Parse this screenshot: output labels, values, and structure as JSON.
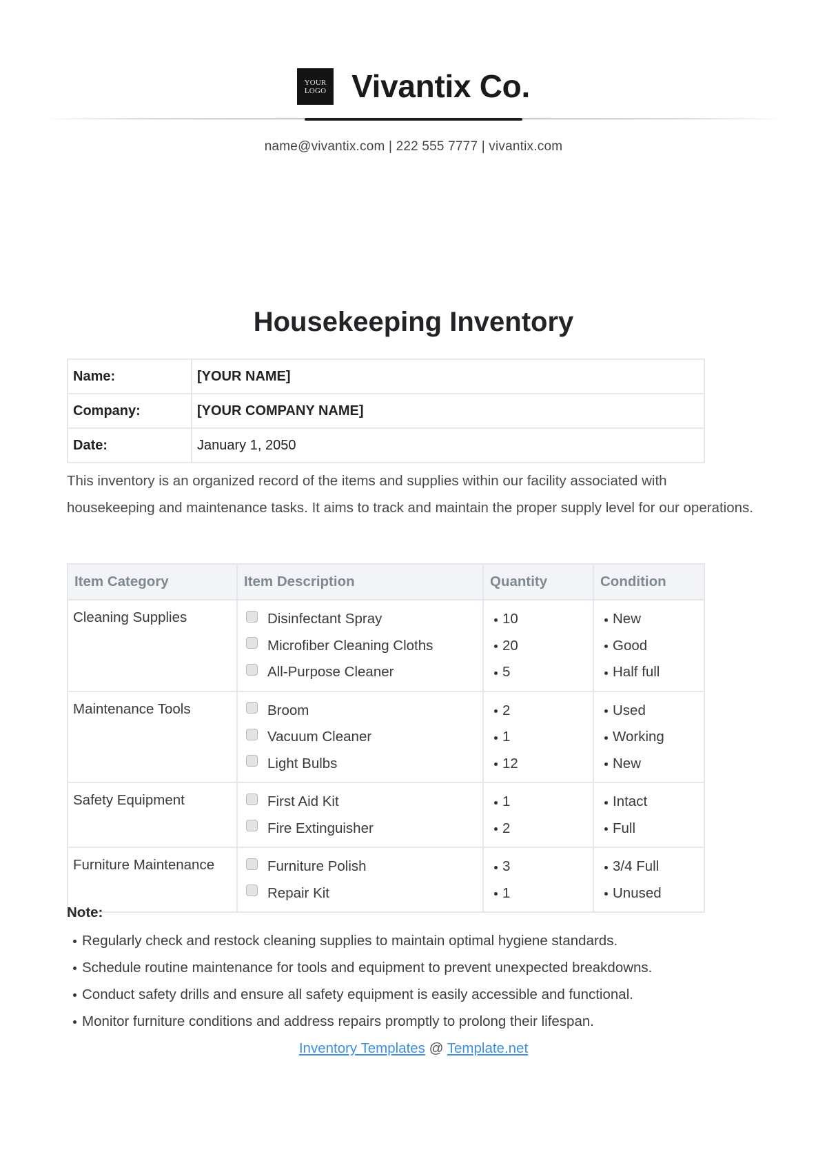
{
  "header": {
    "logo_line1": "YOUR",
    "logo_line2": "LOGO",
    "company_name": "Vivantix Co.",
    "contact": "name@vivantix.com | 222 555 7777 | vivantix.com"
  },
  "title": "Housekeeping Inventory",
  "info": {
    "rows": [
      {
        "label": "Name:",
        "value": "[YOUR NAME]"
      },
      {
        "label": "Company:",
        "value": "[YOUR COMPANY NAME]"
      },
      {
        "label": "Date:",
        "value": "January 1, 2050"
      }
    ]
  },
  "intro": "This inventory is an organized record of the items and supplies within our facility associated with housekeeping and maintenance tasks. It aims to track and maintain the proper supply level for our operations.",
  "inventory": {
    "headers": [
      "Item Category",
      "Item Description",
      "Quantity",
      "Condition"
    ],
    "groups": [
      {
        "category": "Cleaning Supplies",
        "items": [
          {
            "description": "Disinfectant Spray",
            "quantity": "10",
            "condition": "New",
            "checked": false
          },
          {
            "description": "Microfiber Cleaning Cloths",
            "quantity": "20",
            "condition": "Good",
            "checked": false
          },
          {
            "description": "All-Purpose Cleaner",
            "quantity": "5",
            "condition": "Half full",
            "checked": false
          }
        ]
      },
      {
        "category": "Maintenance Tools",
        "items": [
          {
            "description": "Broom",
            "quantity": "2",
            "condition": "Used",
            "checked": false
          },
          {
            "description": "Vacuum Cleaner",
            "quantity": "1",
            "condition": "Working",
            "checked": false
          },
          {
            "description": "Light Bulbs",
            "quantity": "12",
            "condition": "New",
            "checked": false
          }
        ]
      },
      {
        "category": "Safety Equipment",
        "items": [
          {
            "description": "First Aid Kit",
            "quantity": "1",
            "condition": "Intact",
            "checked": false
          },
          {
            "description": "Fire Extinguisher",
            "quantity": "2",
            "condition": "Full",
            "checked": false
          }
        ]
      },
      {
        "category": "Furniture Maintenance",
        "items": [
          {
            "description": "Furniture Polish",
            "quantity": "3",
            "condition": "3/4 Full",
            "checked": false
          },
          {
            "description": "Repair Kit",
            "quantity": "1",
            "condition": "Unused",
            "checked": false
          }
        ]
      }
    ]
  },
  "notes": {
    "heading": "Note:",
    "items": [
      "Regularly check and restock cleaning supplies to maintain optimal hygiene standards.",
      "Schedule routine maintenance for tools and equipment to prevent unexpected breakdowns.",
      "Conduct safety drills and ensure all safety equipment is easily accessible and functional.",
      "Monitor furniture conditions and address repairs promptly to prolong their lifespan."
    ]
  },
  "footer": {
    "link1": "Inventory Templates",
    "separator": "@",
    "link2": "Template.net"
  }
}
